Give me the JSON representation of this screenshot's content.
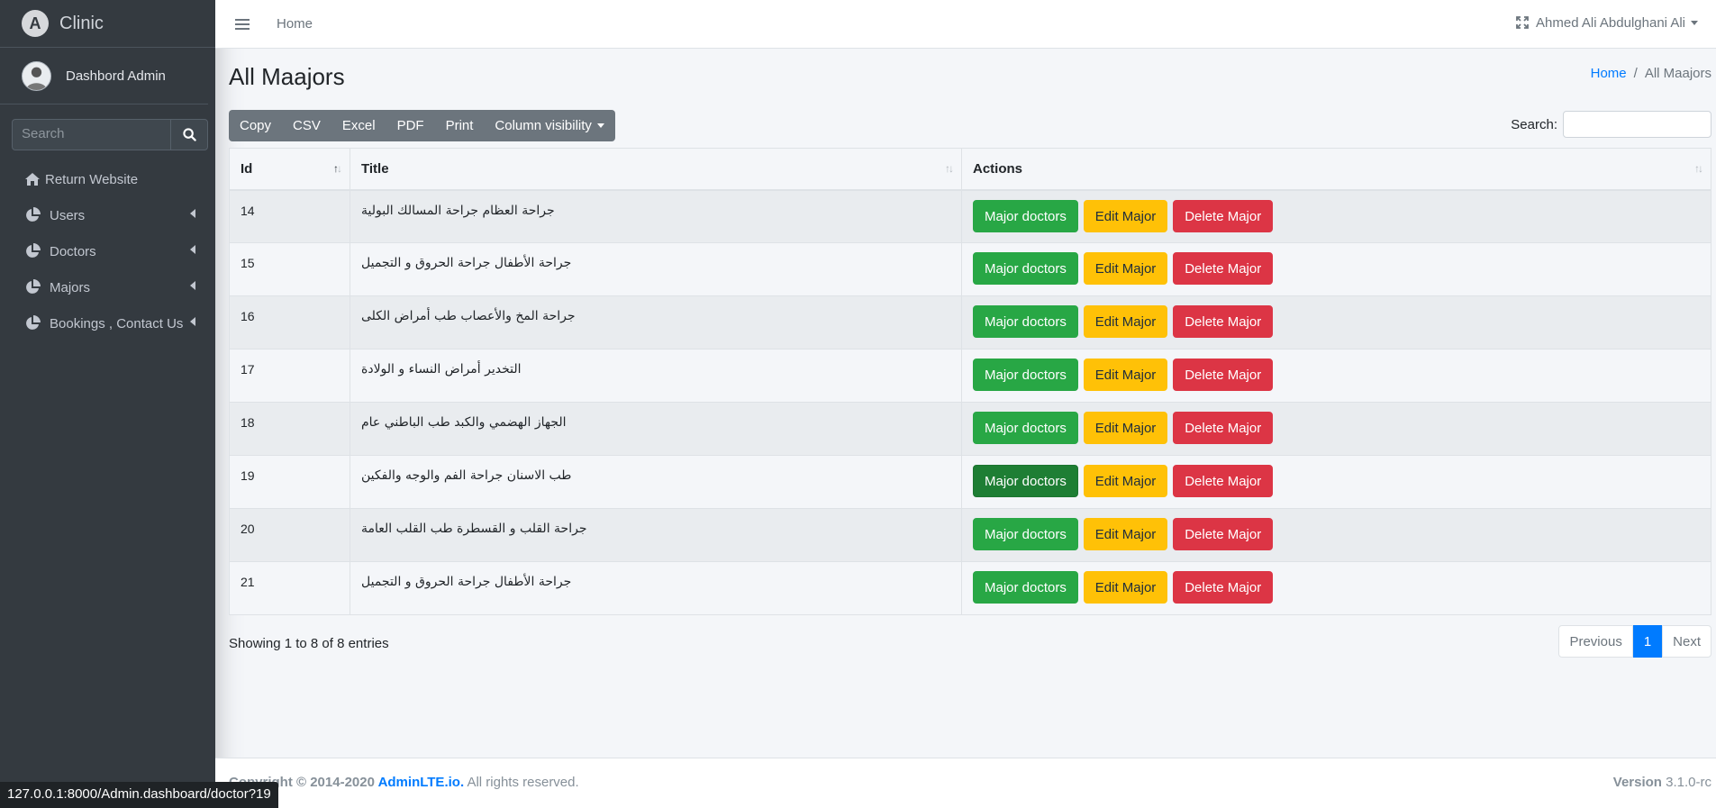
{
  "brand": {
    "name": "Clinic",
    "logo_letter": "A"
  },
  "user": {
    "panel_name": "Dashbord Admin",
    "menu_name": "Ahmed Ali Abdulghani Ali"
  },
  "sidebar": {
    "search_placeholder": "Search",
    "items": [
      {
        "label": "Return Website",
        "icon": "home-icon"
      },
      {
        "label": "Users",
        "icon": "chart-pie-icon"
      },
      {
        "label": "Doctors",
        "icon": "chart-pie-icon"
      },
      {
        "label": "Majors",
        "icon": "chart-pie-icon"
      },
      {
        "label": "Bookings , Contact Us",
        "icon": "chart-pie-icon"
      }
    ]
  },
  "navbar": {
    "home": "Home"
  },
  "page": {
    "title": "All Maajors",
    "breadcrumb": {
      "home": "Home",
      "sep": "/",
      "current": "All Maajors"
    }
  },
  "toolbar": {
    "buttons": [
      "Copy",
      "CSV",
      "Excel",
      "PDF",
      "Print",
      "Column visibility"
    ],
    "search_label": "Search:"
  },
  "table": {
    "headers": [
      "Id",
      "Title",
      "Actions"
    ],
    "rows": [
      {
        "id": "14",
        "title": "جراحة العظام جراحة المسالك البولية"
      },
      {
        "id": "15",
        "title": "جراحة الأطفال جراحة الحروق و التجميل"
      },
      {
        "id": "16",
        "title": "جراحة المخ والأعصاب طب أمراض الكلى"
      },
      {
        "id": "17",
        "title": "التخدير أمراض النساء و الولادة"
      },
      {
        "id": "18",
        "title": "الجهاز الهضمي والكبد طب الباطني عام"
      },
      {
        "id": "19",
        "title": "طب الاسنان جراحة الفم والوجه والفكين"
      },
      {
        "id": "20",
        "title": "جراحة القلب و القسطرة طب القلب العامة"
      },
      {
        "id": "21",
        "title": "جراحة الأطفال جراحة الحروق و التجميل"
      }
    ],
    "actions": {
      "doctors": "Major doctors",
      "edit": "Edit Major",
      "delete": "Delete Major"
    }
  },
  "pagination": {
    "info": "Showing 1 to 8 of 8 entries",
    "previous": "Previous",
    "current": "1",
    "next": "Next"
  },
  "footer": {
    "copyright_prefix": "Copyright © 2014-2020 ",
    "link": "AdminLTE.io.",
    "suffix": " All rights reserved.",
    "version_label": "Version",
    "version": "3.1.0-rc"
  },
  "status_url": "127.0.0.1:8000/Admin.dashboard/doctor?19",
  "colors": {
    "sidebar": "#343a40",
    "green": "#28a745",
    "yellow": "#ffc107",
    "red": "#dc3545",
    "primary": "#007bff"
  }
}
